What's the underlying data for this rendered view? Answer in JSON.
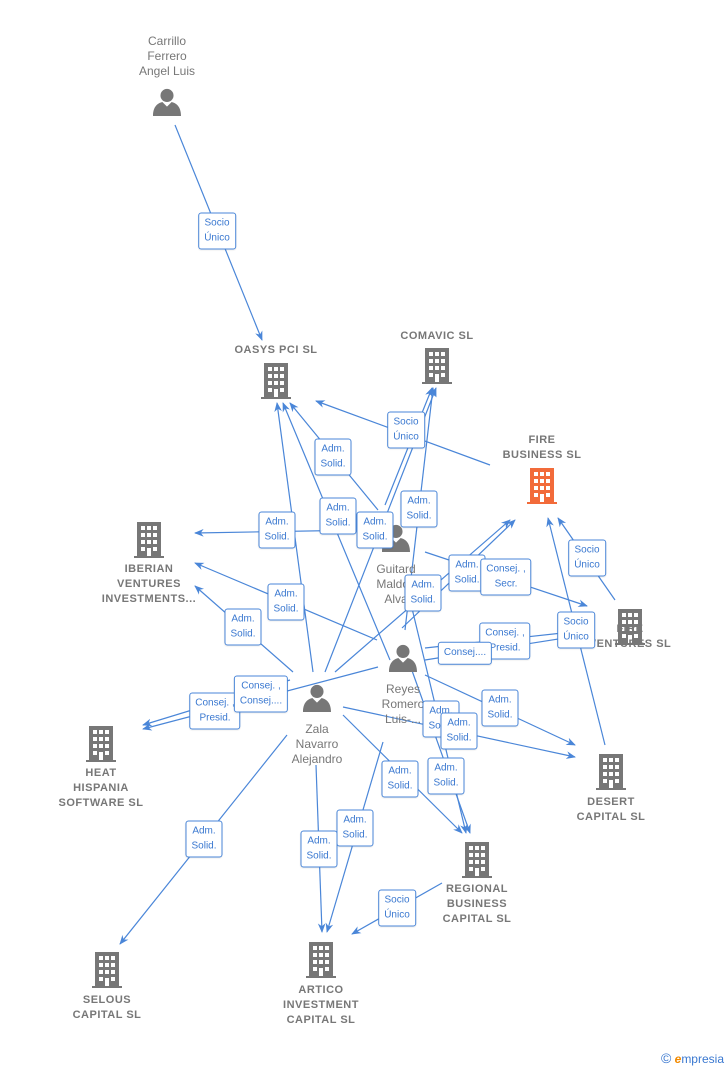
{
  "colors": {
    "edge": "#4a86d8",
    "node": "#777777",
    "highlight": "#f26b3a"
  },
  "persons": [
    {
      "id": "carrillo",
      "lines": [
        "Carrillo",
        "Ferrero",
        "Angel Luis"
      ]
    },
    {
      "id": "guitard",
      "lines": [
        "Guitard",
        "Maldon",
        "Alva"
      ]
    },
    {
      "id": "reyes",
      "lines": [
        "Reyes",
        "Romero",
        "Luis-..."
      ]
    },
    {
      "id": "zala",
      "lines": [
        "Zala",
        "Navarro",
        "Alejandro"
      ]
    }
  ],
  "companies": [
    {
      "id": "oasys",
      "lines": [
        "OASYS PCI  SL"
      ]
    },
    {
      "id": "comavic",
      "lines": [
        "COMAVIC  SL"
      ]
    },
    {
      "id": "fire-business",
      "lines": [
        "FIRE",
        "BUSINESS  SL"
      ],
      "highlight": true
    },
    {
      "id": "iberian",
      "lines": [
        "IBERIAN",
        "VENTURES",
        "INVESTMENTS..."
      ]
    },
    {
      "id": "fire-ventures",
      "lines": [
        "FIRE",
        "VENTURES  SL"
      ]
    },
    {
      "id": "heat",
      "lines": [
        "HEAT",
        "HISPANIA",
        "SOFTWARE  SL"
      ]
    },
    {
      "id": "desert",
      "lines": [
        "DESERT",
        "CAPITAL  SL"
      ]
    },
    {
      "id": "regional",
      "lines": [
        "REGIONAL",
        "BUSINESS",
        "CAPITAL  SL"
      ]
    },
    {
      "id": "selous",
      "lines": [
        "SELOUS",
        "CAPITAL SL"
      ]
    },
    {
      "id": "artico",
      "lines": [
        "ARTICO",
        "INVESTMENT",
        "CAPITAL  SL"
      ]
    }
  ],
  "edge_labels": [
    [
      "Socio",
      "Único"
    ],
    [
      "Socio",
      "Único"
    ],
    [
      "Adm.",
      "Solid."
    ],
    [
      "Adm.",
      "Solid."
    ],
    [
      "Adm.",
      "Solid."
    ],
    [
      "Adm.",
      "Solid."
    ],
    [
      "Adm.",
      "Solid."
    ],
    [
      "Adm.",
      "Solid."
    ],
    [
      "Adm.",
      "Solid."
    ],
    [
      "Adm.",
      "Solid."
    ],
    [
      "Consej. ,",
      "Secr."
    ],
    [
      "Adm.",
      "Solid."
    ],
    [
      "Socio",
      "Único"
    ],
    [
      "Socio",
      "Único"
    ],
    [
      "Consej. ,",
      "Presid."
    ],
    [
      "Consej...."
    ],
    [
      "Consej. ,",
      "Presid."
    ],
    [
      "Consej. ,",
      "Consej...."
    ],
    [
      "Adm.",
      "Solid."
    ],
    [
      "Adm.",
      "Solid."
    ],
    [
      "Adm.",
      "Solid."
    ],
    [
      "Adm.",
      "Solid."
    ],
    [
      "Adm.",
      "Solid."
    ],
    [
      "Adm.",
      "Solid."
    ],
    [
      "Adm.",
      "Solid."
    ],
    [
      "Adm.",
      "Solid."
    ],
    [
      "Socio",
      "Único"
    ]
  ],
  "footer": {
    "copyright": "©",
    "brand_initial": "e",
    "brand_rest": "mpresia"
  }
}
